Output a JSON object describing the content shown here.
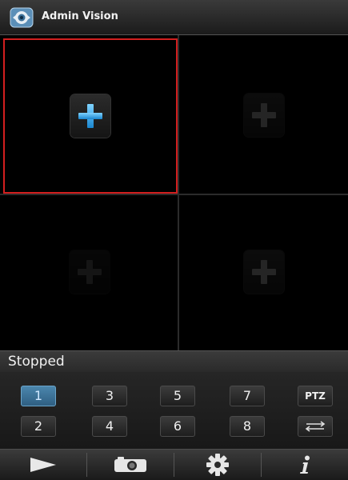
{
  "header": {
    "title": "Admin Vision",
    "icon": "app-logo-icon"
  },
  "grid": {
    "cells": [
      {
        "icon": "add-camera-icon",
        "active": true
      },
      {
        "icon": "add-camera-icon",
        "active": false
      },
      {
        "icon": "add-camera-icon",
        "active": false
      },
      {
        "icon": "add-camera-icon",
        "active": false
      }
    ]
  },
  "status": {
    "text": "Stopped"
  },
  "keypad": {
    "row1": [
      "1",
      "3",
      "5",
      "7",
      "PTZ"
    ],
    "row2": [
      "2",
      "4",
      "6",
      "8"
    ],
    "swap_icon": "swap-arrows-icon",
    "selected": "1"
  },
  "toolbar": {
    "items": [
      {
        "icon": "play-icon"
      },
      {
        "icon": "camera-icon"
      },
      {
        "icon": "gear-icon"
      },
      {
        "icon": "info-icon"
      }
    ]
  },
  "colors": {
    "selection_border": "#d21f1f",
    "plus_active": "#2fa8e8",
    "key_selected": "#3f76a0"
  }
}
